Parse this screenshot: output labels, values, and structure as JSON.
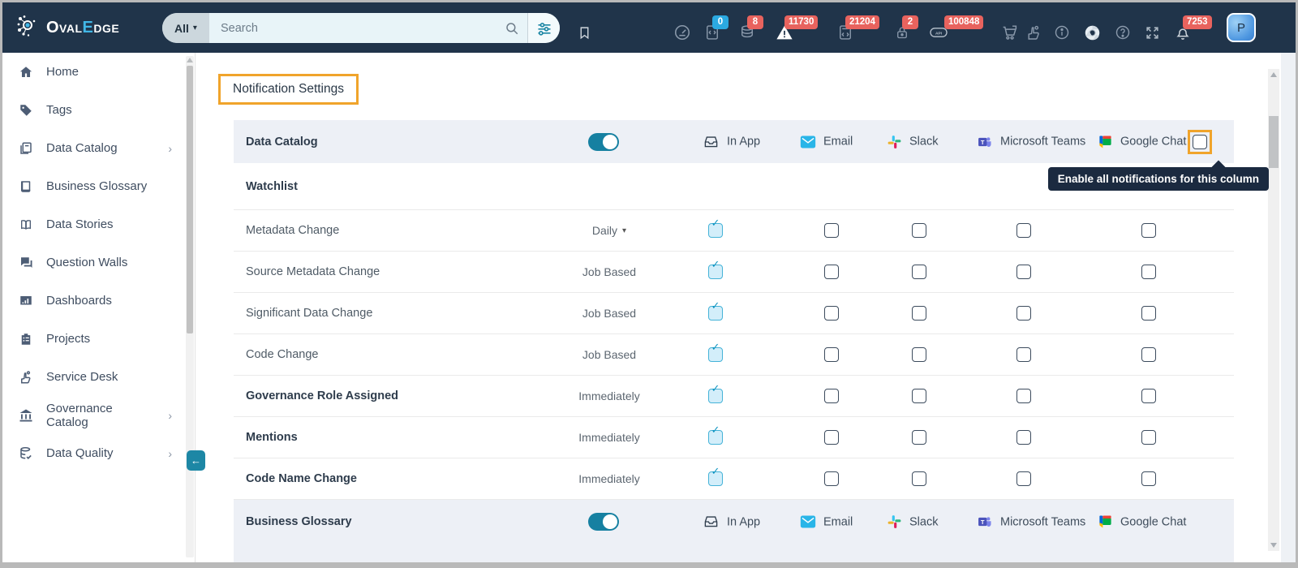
{
  "topbar": {
    "logo": {
      "part1": "Oval",
      "accent": "E",
      "part2": "dge"
    },
    "search": {
      "scope": "All",
      "placeholder": "Search"
    },
    "status_icons": [
      {
        "name": "gauge",
        "badge": null
      },
      {
        "name": "query-sheet",
        "badge": "0",
        "badge_color": "blue"
      },
      {
        "name": "data-sources",
        "badge": "8",
        "badge_color": "red"
      },
      {
        "name": "alerts",
        "badge": "11730",
        "badge_color": "red"
      },
      {
        "name": "code-jobs",
        "badge": "21204",
        "badge_color": "red"
      },
      {
        "name": "security-lock",
        "badge": "2",
        "badge_color": "red"
      },
      {
        "name": "api",
        "badge": "100848",
        "badge_color": "red"
      },
      {
        "name": "cart",
        "badge": null
      },
      {
        "name": "hand-pen",
        "badge": null
      },
      {
        "name": "info",
        "badge": null
      },
      {
        "name": "browser",
        "badge": null
      },
      {
        "name": "help",
        "badge": null
      },
      {
        "name": "expand",
        "badge": null
      },
      {
        "name": "notifications-bell",
        "badge": "7253",
        "badge_color": "red"
      }
    ],
    "avatar_initial": "P"
  },
  "sidebar": {
    "items": [
      {
        "label": "Home",
        "has_submenu": false
      },
      {
        "label": "Tags",
        "has_submenu": false
      },
      {
        "label": "Data Catalog",
        "has_submenu": true
      },
      {
        "label": "Business Glossary",
        "has_submenu": false
      },
      {
        "label": "Data Stories",
        "has_submenu": false
      },
      {
        "label": "Question Walls",
        "has_submenu": false
      },
      {
        "label": "Dashboards",
        "has_submenu": false
      },
      {
        "label": "Projects",
        "has_submenu": false
      },
      {
        "label": "Service Desk",
        "has_submenu": false
      },
      {
        "label": "Governance Catalog",
        "has_submenu": true
      },
      {
        "label": "Data Quality",
        "has_submenu": true
      }
    ],
    "submenu_arrow": "›",
    "collapse_arrow": "←"
  },
  "main": {
    "title": "Notification Settings",
    "channels": [
      {
        "label": "In App"
      },
      {
        "label": "Email"
      },
      {
        "label": "Slack"
      },
      {
        "label": "Microsoft Teams"
      },
      {
        "label": "Google Chat"
      }
    ],
    "sections": [
      {
        "label": "Data Catalog",
        "enabled": true
      },
      {
        "label": "Business Glossary",
        "enabled": true
      }
    ],
    "group_label": "Watchlist",
    "rows": [
      {
        "label": "Metadata Change",
        "frequency": "Daily",
        "has_dropdown": true,
        "bold": false,
        "checks": [
          true,
          false,
          false,
          false,
          false
        ]
      },
      {
        "label": "Source Metadata Change",
        "frequency": "Job Based",
        "has_dropdown": false,
        "bold": false,
        "checks": [
          true,
          false,
          false,
          false,
          false
        ]
      },
      {
        "label": "Significant Data Change",
        "frequency": "Job Based",
        "has_dropdown": false,
        "bold": false,
        "checks": [
          true,
          false,
          false,
          false,
          false
        ]
      },
      {
        "label": "Code Change",
        "frequency": "Job Based",
        "has_dropdown": false,
        "bold": false,
        "checks": [
          true,
          false,
          false,
          false,
          false
        ]
      },
      {
        "label": "Governance Role Assigned",
        "frequency": "Immediately",
        "has_dropdown": false,
        "bold": true,
        "checks": [
          true,
          false,
          false,
          false,
          false
        ]
      },
      {
        "label": "Mentions",
        "frequency": "Immediately",
        "has_dropdown": false,
        "bold": true,
        "checks": [
          true,
          false,
          false,
          false,
          false
        ]
      },
      {
        "label": "Code Name Change",
        "frequency": "Immediately",
        "has_dropdown": false,
        "bold": true,
        "checks": [
          true,
          false,
          false,
          false,
          false
        ]
      }
    ],
    "tooltip": "Enable all notifications for this column",
    "dropdown_caret": "▾"
  },
  "colors": {
    "topbar_bg": "#20344a",
    "accent_teal": "#1680a1",
    "highlight_orange": "#f0a42b",
    "tooltip_bg": "#1b2a40",
    "badge_red": "#e8635e",
    "badge_blue": "#2ba9e1",
    "section_row_bg": "#edf0f6",
    "checked_checkbox": "#d3eefa"
  }
}
